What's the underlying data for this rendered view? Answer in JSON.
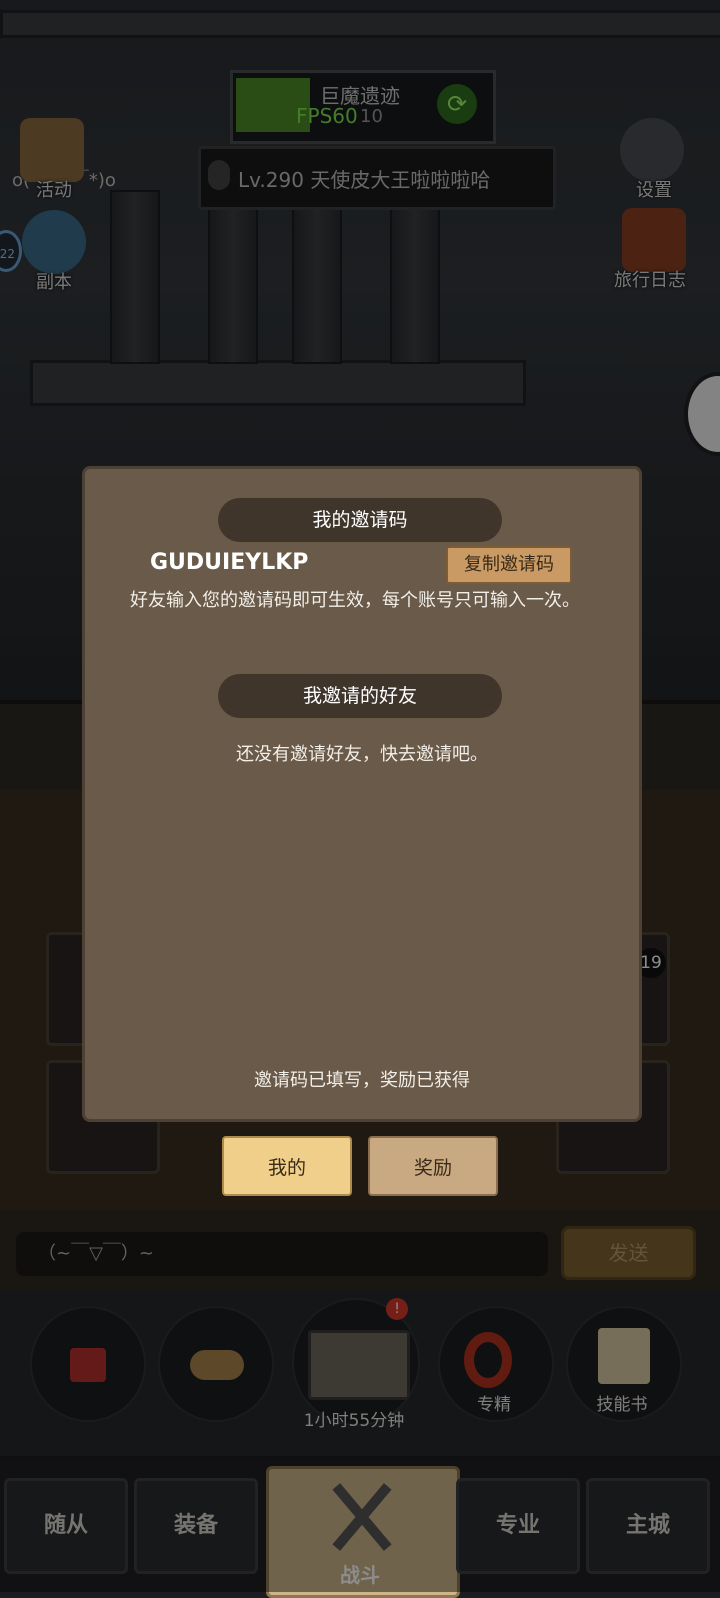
{
  "hud": {
    "map_title": "巨魔遗迹",
    "fps": "FPS60",
    "map_sub": "10",
    "player_line": "Lv.290 天使皮大王啦啦啦哈",
    "emoticon": "o(*￣▽￣*)o"
  },
  "side_left": [
    {
      "label": "活动",
      "icon": "scroll-icon"
    },
    {
      "label": "副本",
      "icon": "portal-icon"
    }
  ],
  "side_right": [
    {
      "label": "设置",
      "icon": "gear-icon"
    },
    {
      "label": "旅行日志",
      "icon": "book-icon"
    }
  ],
  "left_badge": "22",
  "slot_count_badge": "19",
  "modal": {
    "section1_title": "我的邀请码",
    "invite_code": "GUDUIEYLKP",
    "copy_button": "复制邀请码",
    "description": "好友输入您的邀请码即可生效，每个账号只可输入一次。",
    "section2_title": "我邀请的好友",
    "empty_text": "还没有邀请好友，快去邀请吧。",
    "status_text": "邀请码已填写，奖励已获得",
    "tab_mine": "我的",
    "tab_rewards": "奖励"
  },
  "chat": {
    "input_text": "（~￣▽￣）~",
    "send_label": "发送"
  },
  "skills": [
    {
      "label": "",
      "icon": "potion-icon"
    },
    {
      "label": "",
      "icon": "bread-icon"
    },
    {
      "label": "1小时55分钟",
      "icon": "treasure-chest-icon"
    },
    {
      "label": "专精",
      "icon": "target-icon"
    },
    {
      "label": "技能书",
      "icon": "skill-book-icon"
    }
  ],
  "nav": {
    "followers": "随从",
    "equipment": "装备",
    "battle": "战斗",
    "profession": "专业",
    "main_city": "主城"
  },
  "colors": {
    "modal_bg": "#6a5a49",
    "banner_bg": "#3f352b",
    "tab_active": "#f0cf8a",
    "tab_inactive": "#c9a982",
    "copy_btn": "#c99a63"
  }
}
